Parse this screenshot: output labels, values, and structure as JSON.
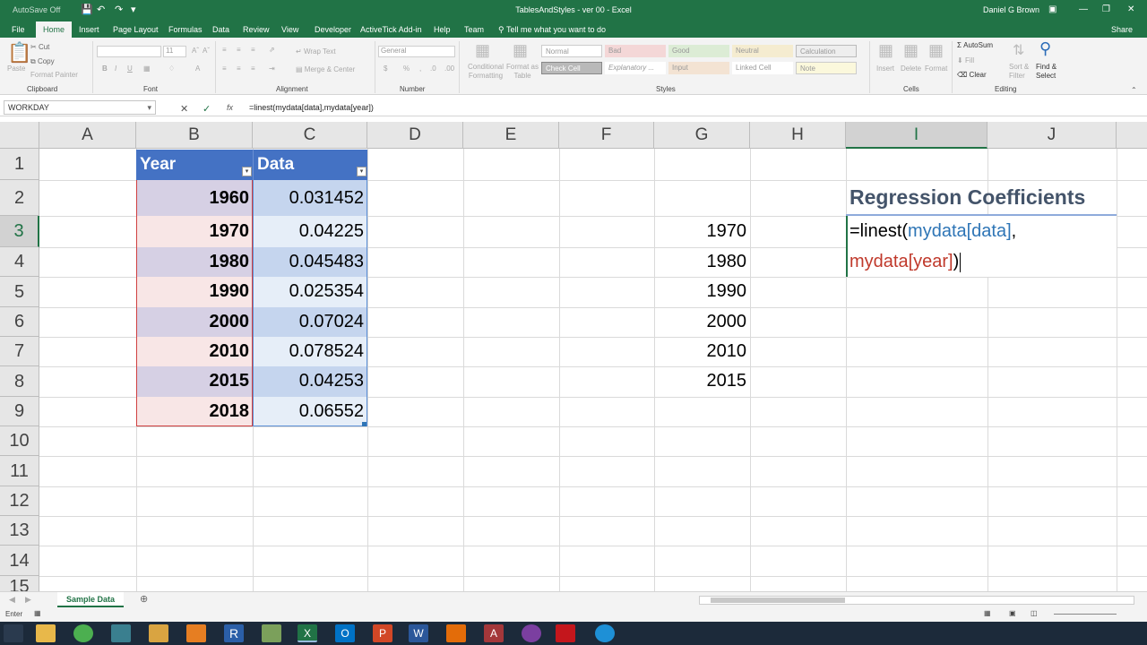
{
  "title_bar": {
    "autosave": "AutoSave",
    "autosave_state": "Off",
    "doc_title": "TablesAndStyles - ver 00 - Excel",
    "user": "Daniel G Brown"
  },
  "ribbon_tabs": [
    "File",
    "Home",
    "Insert",
    "Page Layout",
    "Formulas",
    "Data",
    "Review",
    "View",
    "Developer",
    "ActiveTick Add-in",
    "Help",
    "Team"
  ],
  "tell_me": "Tell me what you want to do",
  "share": "Share",
  "ribbon": {
    "paste": "Paste",
    "cut": "Cut",
    "copy": "Copy",
    "format_painter": "Format Painter",
    "font_size": "11",
    "wrap_text": "Wrap Text",
    "merge_center": "Merge & Center",
    "number_format": "General",
    "conditional_formatting": "Conditional Formatting",
    "format_as_table": "Format as Table",
    "styles": [
      "Normal",
      "Bad",
      "Good",
      "Neutral",
      "Calculation",
      "Check Cell",
      "Explanatory ...",
      "Input",
      "Linked Cell",
      "Note"
    ],
    "cells_buttons": [
      "Insert",
      "Delete",
      "Format"
    ],
    "autosum": "AutoSum",
    "fill": "Fill",
    "clear": "Clear",
    "sort_filter": "Sort & Filter",
    "find_select": "Find & Select",
    "groups": [
      "Clipboard",
      "Font",
      "Alignment",
      "Number",
      "Styles",
      "Cells",
      "Editing"
    ]
  },
  "formula_bar": {
    "name_box": "WORKDAY",
    "fx": "fx",
    "formula": "=linest(mydata[data],mydata[year])"
  },
  "columns": [
    "A",
    "B",
    "C",
    "D",
    "E",
    "F",
    "G",
    "H",
    "I",
    "J"
  ],
  "rows": [
    "1",
    "2",
    "3",
    "4",
    "5",
    "6",
    "7",
    "8",
    "9",
    "10",
    "11",
    "12",
    "13",
    "14",
    "15"
  ],
  "table": {
    "header_year": "Year",
    "header_data": "Data",
    "rows": [
      {
        "year": "1960",
        "data": "0.031452"
      },
      {
        "year": "1970",
        "data": "0.04225"
      },
      {
        "year": "1980",
        "data": "0.045483"
      },
      {
        "year": "1990",
        "data": "0.025354"
      },
      {
        "year": "2000",
        "data": "0.07024"
      },
      {
        "year": "2010",
        "data": "0.078524"
      },
      {
        "year": "2015",
        "data": "0.04253"
      },
      {
        "year": "2018",
        "data": "0.06552"
      }
    ]
  },
  "column_g": [
    "1970",
    "1980",
    "1990",
    "2000",
    "2010",
    "2015"
  ],
  "regression_title": "Regression Coefficients",
  "editing_formula": {
    "fn": "=linest(",
    "arg1": "mydata[data]",
    "comma": ",",
    "arg2": "mydata[year]",
    "close": ")"
  },
  "sheet_tab": "Sample Data",
  "status": "Enter",
  "colors": {
    "excel_green": "#217346",
    "table_header": "#4472c4",
    "year_band_dark": "#d6d0e4",
    "year_band_light": "#f8e6e6",
    "data_band_dark": "#c5d5ee",
    "data_band_light": "#e6eef8",
    "arg1_color": "#2e75b6",
    "arg2_color": "#c0392b"
  }
}
